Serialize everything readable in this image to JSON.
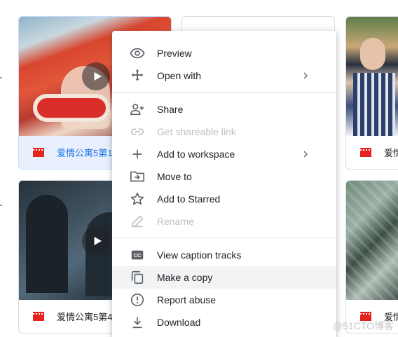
{
  "cards": [
    {
      "title": "爱情公寓5第1",
      "selected": true
    },
    {
      "title": "",
      "selected": false
    },
    {
      "title": "爱情",
      "selected": false
    },
    {
      "title": "爱情公寓5第4",
      "selected": false
    },
    {
      "title": "爱情",
      "selected": false
    }
  ],
  "menu": {
    "preview": "Preview",
    "open_with": "Open with",
    "share": "Share",
    "get_link": "Get shareable link",
    "add_workspace": "Add to workspace",
    "move_to": "Move to",
    "add_starred": "Add to Starred",
    "rename": "Rename",
    "view_captions": "View caption tracks",
    "make_copy": "Make a copy",
    "report_abuse": "Report abuse",
    "download": "Download"
  },
  "icons": {
    "preview": "eye-icon",
    "open_with": "move-arrows-icon",
    "share": "add-person-icon",
    "get_link": "link-icon",
    "add_workspace": "plus-icon",
    "move_to": "folder-move-icon",
    "add_starred": "star-outline-icon",
    "rename": "pencil-icon",
    "view_captions": "closed-caption-icon",
    "make_copy": "copy-icon",
    "report_abuse": "alert-circle-icon",
    "download": "download-icon",
    "video": "film-icon",
    "play": "play-icon"
  },
  "watermark": "@51CTO博客",
  "colors": {
    "video_icon": "#e52420",
    "selected_card_bg": "#e8f0fe",
    "selected_title": "#1a73e8",
    "hover_item": "#f1f3f4",
    "disabled_text": "#bdc1c6"
  }
}
